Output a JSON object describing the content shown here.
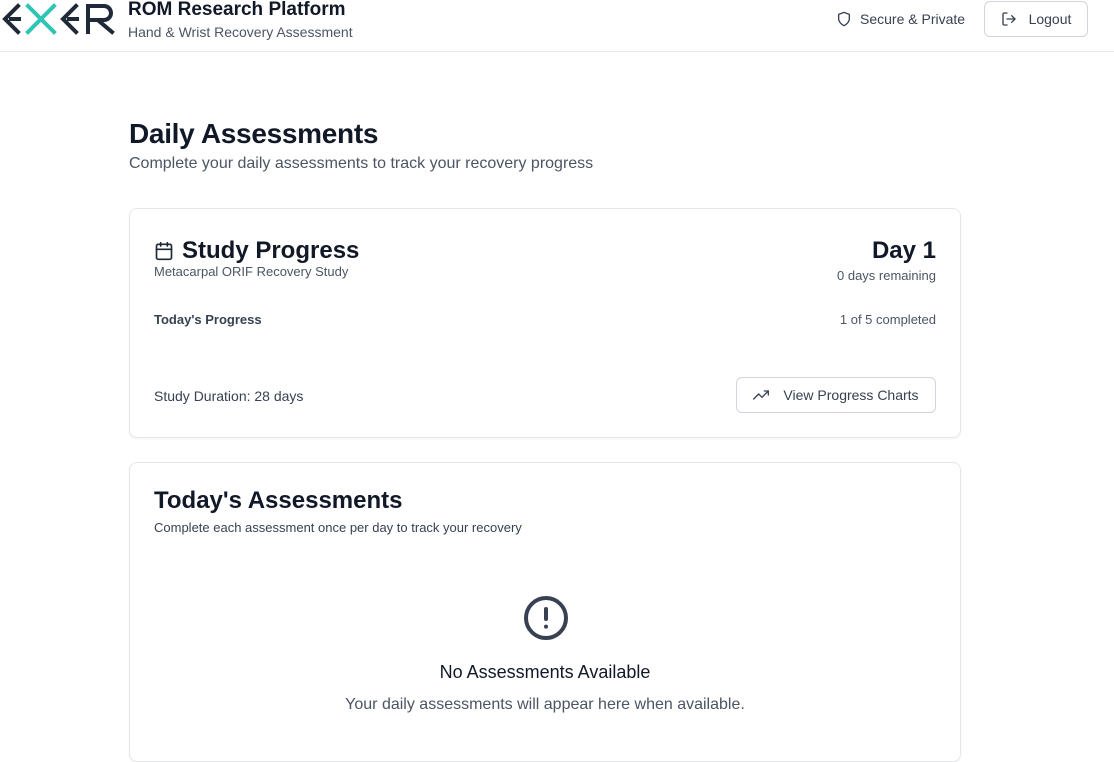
{
  "header": {
    "logo_text": "EXER",
    "app_title": "ROM Research Platform",
    "app_subtitle": "Hand & Wrist Recovery Assessment",
    "secure_label": "Secure & Private",
    "logout_label": "Logout",
    "colors": {
      "logo_dark": "#1f2937",
      "logo_accent": "#2ec4b6"
    }
  },
  "page": {
    "title": "Daily Assessments",
    "subtitle": "Complete your daily assessments to track your recovery progress"
  },
  "study_progress": {
    "title": "Study Progress",
    "study_name": "Metacarpal ORIF Recovery Study",
    "day_label": "Day 1",
    "remaining_label": "0 days remaining",
    "todays_progress_label": "Today's Progress",
    "completed_label": "1 of 5 completed",
    "completed_count": 1,
    "total_count": 5,
    "duration_label": "Study Duration: 28 days",
    "charts_button_label": "View Progress Charts"
  },
  "todays_assessments": {
    "title": "Today's Assessments",
    "subtitle": "Complete each assessment once per day to track your recovery",
    "empty_title": "No Assessments Available",
    "empty_message": "Your daily assessments will appear here when available."
  },
  "icons": {
    "secure": "shield-icon",
    "logout": "log-out-icon",
    "study": "calendar-icon",
    "charts": "trending-up-icon",
    "empty": "alert-circle-icon"
  }
}
